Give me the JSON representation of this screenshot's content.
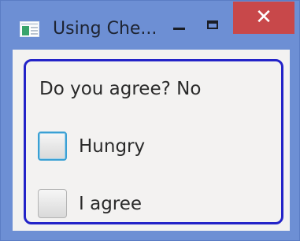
{
  "window": {
    "title": "Using Che...",
    "close_glyph": "✕",
    "icons": {
      "app": "java-app-icon",
      "minimize": "minimize-icon",
      "maximize": "maximize-icon",
      "close": "close-icon"
    },
    "colors": {
      "frame": "#6d8fd4",
      "close": "#c8484a",
      "focus_ring": "#2323c8",
      "checkbox_focus": "#3aa0d4"
    }
  },
  "content": {
    "status_prefix": "Do you agree?",
    "status_value": "No",
    "checkboxes": [
      {
        "label": "Hungry",
        "checked": false,
        "focused": true
      },
      {
        "label": "I agree",
        "checked": false,
        "focused": false
      }
    ]
  }
}
